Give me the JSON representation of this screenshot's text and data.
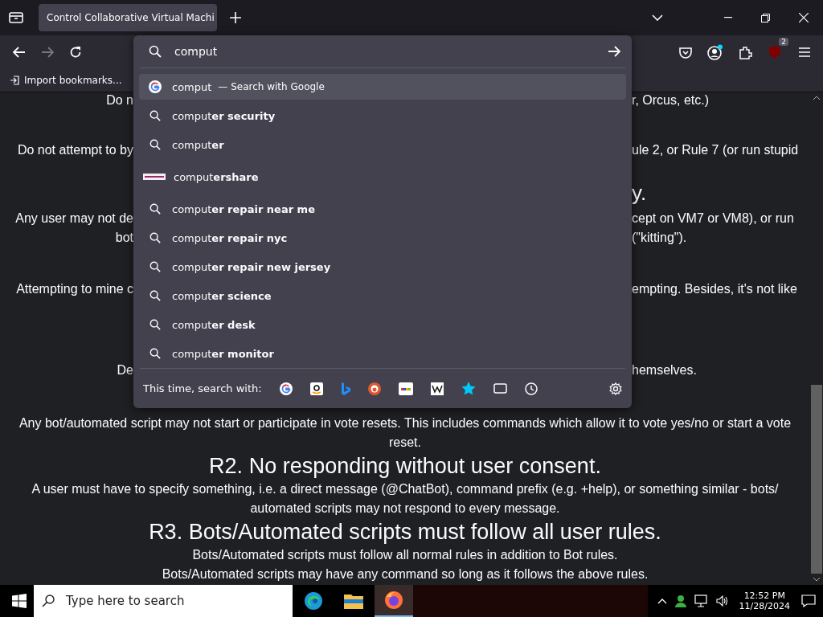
{
  "tab_strip": {
    "tabs": [
      {
        "title": "Control Collaborative Virtual Machi",
        "selected": true
      }
    ]
  },
  "toolbar": {
    "address": {
      "value": "comput"
    },
    "extension_badge": "2"
  },
  "bookmarks_bar": {
    "items": [
      "Import bookmarks..."
    ]
  },
  "suggestions": [
    {
      "kind": "engine",
      "typed": "comput",
      "note": "— Search with Google",
      "selected": true
    },
    {
      "kind": "search",
      "typed": "comput",
      "completion": "er security",
      "selected": false
    },
    {
      "kind": "search",
      "typed": "comput",
      "completion": "er",
      "selected": false
    },
    {
      "kind": "site",
      "typed": "comput",
      "completion": "ershare",
      "selected": false
    },
    {
      "kind": "search",
      "typed": "comput",
      "completion": "er repair near me",
      "selected": false
    },
    {
      "kind": "search",
      "typed": "comput",
      "completion": "er repair nyc",
      "selected": false
    },
    {
      "kind": "search",
      "typed": "comput",
      "completion": "er repair new jersey",
      "selected": false
    },
    {
      "kind": "search",
      "typed": "comput",
      "completion": "er science",
      "selected": false
    },
    {
      "kind": "search",
      "typed": "comput",
      "completion": "er desk",
      "selected": false
    },
    {
      "kind": "search",
      "typed": "comput",
      "completion": "er monitor",
      "selected": false
    }
  ],
  "search_with": {
    "label": "This time, search with:"
  },
  "page_fragments": [
    {
      "kind": "text",
      "left": "Do n",
      "right": "r, Orcus, etc.)"
    },
    {
      "kind": "text",
      "left": "Do not attempt to by",
      "right": "ule 2, or Rule 7 (or run stupid"
    },
    {
      "kind": "heading",
      "right": "y."
    },
    {
      "kind": "text",
      "left": "Any user may not de",
      "right": "cept on VM7 or VM8), or run"
    },
    {
      "kind": "text",
      "left": "bot",
      "right": "(\"kitting\")."
    },
    {
      "kind": "text",
      "left": "Attempting to mine c",
      "right": "empting. Besides, it's not like"
    },
    {
      "kind": "text",
      "left": "De",
      "right": "hemselves."
    }
  ],
  "page_blocks": [
    {
      "kind": "paragraph",
      "text": "Any bot/automated script may not start or participate in vote resets. This includes commands which allow it to vote yes/no or start a vote reset."
    },
    {
      "kind": "heading",
      "text": "R2. No responding without user consent."
    },
    {
      "kind": "paragraph",
      "text": "A user must have to specify something, i.e. a direct message (@ChatBot), command prefix (e.g. +help), or something similar - bots/ automated scripts may not respond to every message."
    },
    {
      "kind": "heading",
      "text": "R3. Bots/Automated scripts must follow all user rules."
    },
    {
      "kind": "paragraph",
      "text": "Bots/Automated scripts must follow all normal rules in addition to Bot rules."
    },
    {
      "kind": "paragraph",
      "text": "Bots/Automated scripts may have any command so long as it follows the above rules."
    }
  ],
  "taskbar": {
    "search": {
      "placeholder": "Type here to search"
    },
    "time": "12:52 PM",
    "date": "11/28/2024"
  }
}
